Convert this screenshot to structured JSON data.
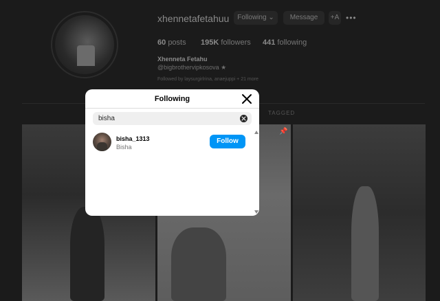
{
  "profile": {
    "username": "xhennetafetahuu",
    "following_button": "Following",
    "message_button": "Message",
    "add_button": "+A",
    "more_button": "•••",
    "posts_count": "60",
    "posts_label": "posts",
    "followers_count": "195K",
    "followers_label": "followers",
    "following_count": "441",
    "following_label": "following",
    "full_name": "Xhenneta Fetahu",
    "handle": "@bigbrothervipkosova ★",
    "followed_by": "Followed by laysurgirlrina, anaejuppi + 21 more",
    "tab_tagged": "TAGGED"
  },
  "modal": {
    "title": "Following",
    "search_value": "bisha",
    "results": [
      {
        "username": "bisha_1313",
        "name": "Bisha",
        "button": "Follow"
      }
    ]
  },
  "icons": {
    "close": "close-icon",
    "clear": "clear-search-icon",
    "chevron": "chevron-down-icon",
    "pin": "pin-icon"
  },
  "colors": {
    "accent": "#0095f6",
    "modal_bg": "#ffffff",
    "backdrop": "#1b1b1b"
  }
}
